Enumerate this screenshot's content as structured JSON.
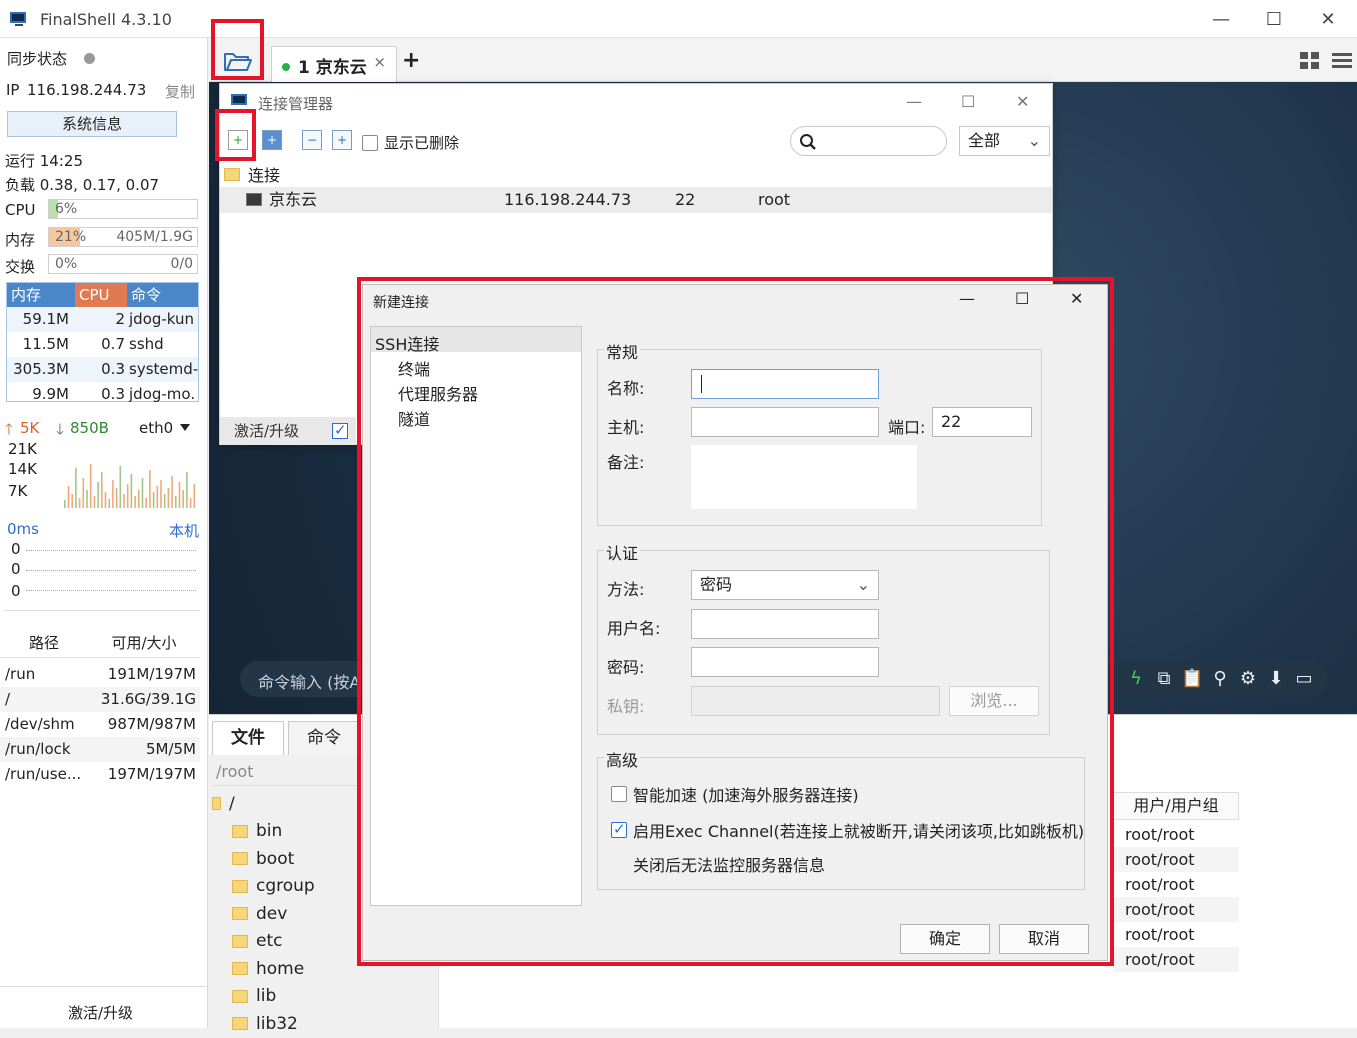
{
  "window": {
    "title": "FinalShell 4.3.10",
    "minimize": "—",
    "maximize": "☐",
    "close": "✕"
  },
  "sidebar": {
    "sync_label": "同步状态",
    "ip_label": "IP",
    "ip": "116.198.244.73",
    "copy": "复制",
    "sysinfo_button": "系统信息",
    "uptime": "运行 14:25",
    "load": "负载 0.38, 0.17, 0.07",
    "cpu": {
      "label": "CPU",
      "value": "6%",
      "fraction": 0.06
    },
    "mem": {
      "label": "内存",
      "value": "21%",
      "detail": "405M/1.9G",
      "fraction": 0.21
    },
    "swap": {
      "label": "交换",
      "value": "0%",
      "detail": "0/0",
      "fraction": 0
    },
    "proc_headers": [
      "内存",
      "CPU",
      "命令"
    ],
    "processes": [
      {
        "mem": "59.1M",
        "cpu": "2",
        "cmd": "jdog-kun"
      },
      {
        "mem": "11.5M",
        "cpu": "0.7",
        "cmd": "sshd"
      },
      {
        "mem": "305.3M",
        "cpu": "0.3",
        "cmd": "systemd-"
      },
      {
        "mem": "9.9M",
        "cpu": "0.3",
        "cmd": "jdog-mo."
      }
    ],
    "net": {
      "up": "5K",
      "down": "850B",
      "iface": "eth0",
      "y_labels": [
        "21K",
        "14K",
        "7K"
      ]
    },
    "ping": {
      "latency": "0ms",
      "target": "本机",
      "values": [
        "0",
        "0",
        "0"
      ]
    },
    "disk_headers": [
      "路径",
      "可用/大小"
    ],
    "disks": [
      {
        "path": "/run",
        "size": "191M/197M"
      },
      {
        "path": "/",
        "size": "31.6G/39.1G"
      },
      {
        "path": "/dev/shm",
        "size": "987M/987M"
      },
      {
        "path": "/run/lock",
        "size": "5M/5M"
      },
      {
        "path": "/run/use...",
        "size": "197M/197M"
      }
    ],
    "activate": "激活/升级"
  },
  "tabs": {
    "session": "1 京东云",
    "close": "×",
    "add": "+"
  },
  "terminal": {
    "cmd_placeholder": "命令输入 (按A"
  },
  "bottom": {
    "tabs": [
      "文件",
      "命令"
    ],
    "path": "/root",
    "tree": [
      "/",
      "bin",
      "boot",
      "cgroup",
      "dev",
      "etc",
      "home",
      "lib",
      "lib32"
    ],
    "owner_header": "用户/用户组",
    "owners": [
      "root/root",
      "root/root",
      "root/root",
      "root/root",
      "root/root",
      "root/root"
    ]
  },
  "conn_manager": {
    "title": "连接管理器",
    "show_deleted": "显示已删除",
    "filter": "全部",
    "root": "连接",
    "row": {
      "name": "京东云",
      "host": "116.198.244.73",
      "port": "22",
      "user": "root"
    },
    "activate": "激活/升级"
  },
  "new_conn": {
    "title": "新建连接",
    "nav": [
      "SSH连接",
      "终端",
      "代理服务器",
      "隧道"
    ],
    "general": {
      "title": "常规",
      "name": "名称:",
      "host": "主机:",
      "port_label": "端口:",
      "port": "22",
      "note": "备注:"
    },
    "auth": {
      "title": "认证",
      "method_label": "方法:",
      "method": "密码",
      "user": "用户名:",
      "pass": "密码:",
      "key": "私钥:",
      "browse": "浏览..."
    },
    "advanced": {
      "title": "高级",
      "smart": "智能加速 (加速海外服务器连接)",
      "exec": "启用Exec Channel(若连接上就被断开,请关闭该项,比如跳板机)",
      "exec_note": "关闭后无法监控服务器信息"
    },
    "ok": "确定",
    "cancel": "取消"
  },
  "colors": {
    "highlight": "#e5142a",
    "cpu_fill": "#b9e0a8",
    "mem_fill": "#f5c8a0",
    "proc_head": "#4a86c8",
    "cpu_head": "#e07a50"
  }
}
